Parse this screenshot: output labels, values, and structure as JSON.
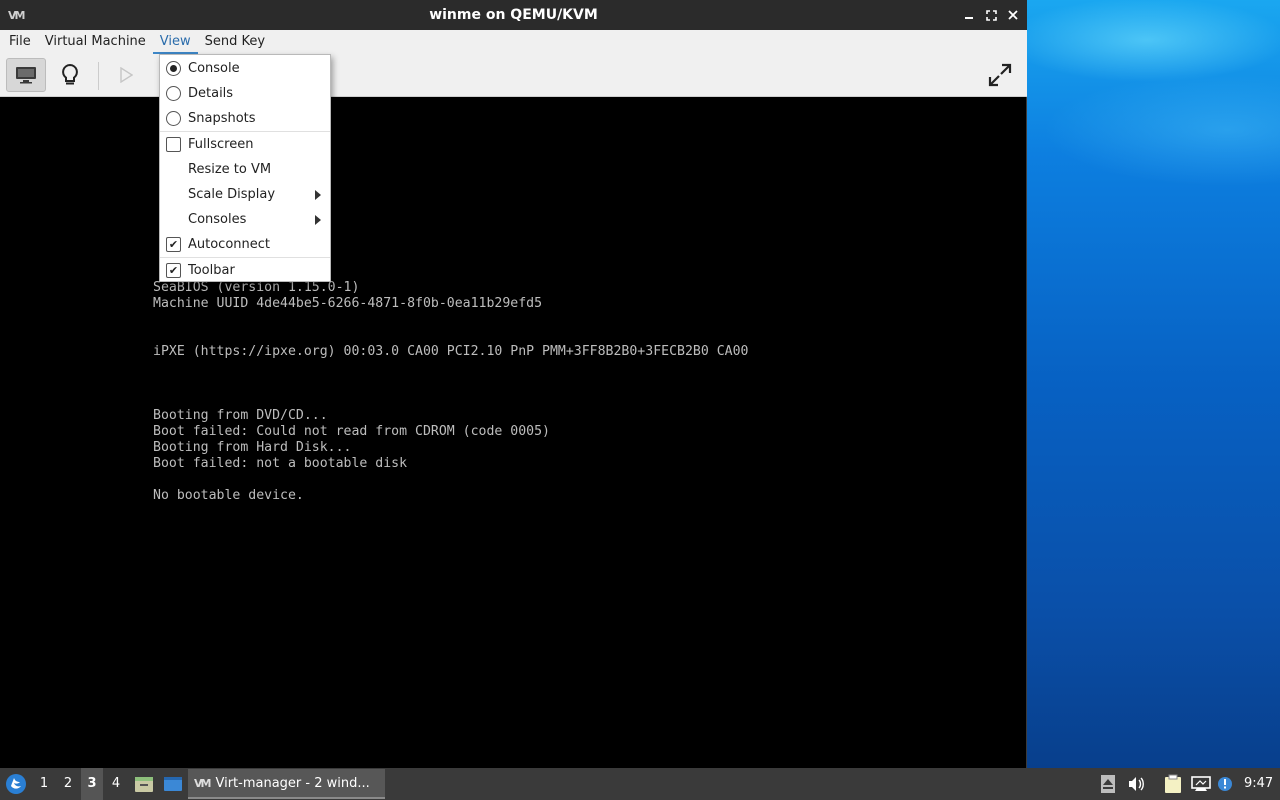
{
  "window": {
    "title": "winme on QEMU/KVM",
    "app_icon_text": "VM"
  },
  "menubar": {
    "items": [
      "File",
      "Virtual Machine",
      "View",
      "Send Key"
    ]
  },
  "view_menu": {
    "console": "Console",
    "details": "Details",
    "snapshots": "Snapshots",
    "fullscreen": "Fullscreen",
    "resize_to_vm": "Resize to VM",
    "scale_display": "Scale Display",
    "consoles": "Consoles",
    "autoconnect": "Autoconnect",
    "toolbar": "Toolbar",
    "selected_view": "Console",
    "fullscreen_checked": false,
    "autoconnect_checked": true,
    "toolbar_checked": true
  },
  "console": {
    "lines": [
      "SeaBIOS (version 1.15.0-1)",
      "Machine UUID 4de44be5-6266-4871-8f0b-0ea11b29efd5",
      "",
      "",
      "iPXE (https://ipxe.org) 00:03.0 CA00 PCI2.10 PnP PMM+3FF8B2B0+3FECB2B0 CA00",
      "",
      "",
      "",
      "Booting from DVD/CD...",
      "Boot failed: Could not read from CDROM (code 0005)",
      "Booting from Hard Disk...",
      "Boot failed: not a bootable disk",
      "",
      "No bootable device."
    ]
  },
  "taskbar": {
    "workspaces": [
      "1",
      "2",
      "3",
      "4"
    ],
    "active_workspace": "3",
    "task_label": "Virt-manager - 2 wind...",
    "clock": "9:47"
  },
  "colors": {
    "titlebar": "#2b2b2b",
    "menubar": "#f0f0f0",
    "accent": "#3d86c6",
    "console_text": "#bdbdbd",
    "taskbar": "#3a3a3a"
  }
}
